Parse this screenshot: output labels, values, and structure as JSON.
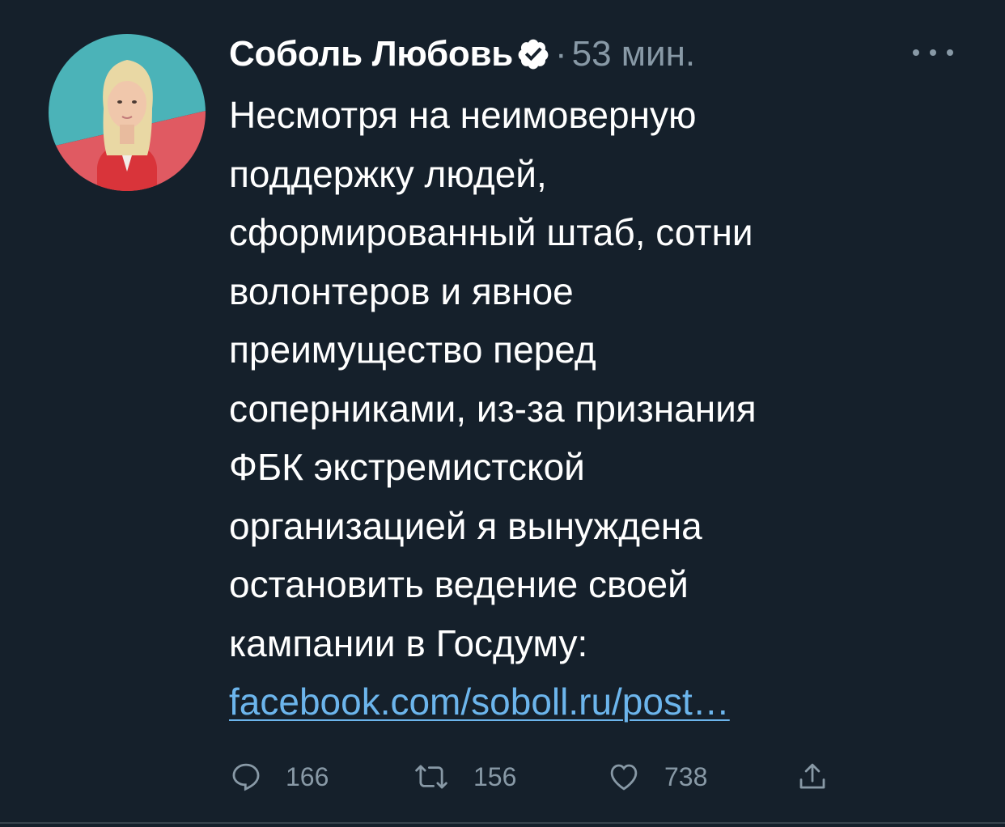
{
  "tweet": {
    "author_name": "Соболь Любовь",
    "separator": "·",
    "time": "53 мин.",
    "text_lines": [
      "Несмотря на неимоверную",
      "поддержку людей,",
      "сформированный штаб, сотни",
      "волонтеров и явное",
      "преимущество перед",
      "соперниками, из-за признания",
      "ФБК экстремистской",
      "организацией я вынуждена",
      "остановить ведение своей",
      "кампании в Госдуму:"
    ],
    "link": "facebook.com/soboll.ru/post…",
    "replies": "166",
    "retweets": "156",
    "likes": "738"
  },
  "icons": {
    "more": "more-icon",
    "verified": "verified-badge-icon",
    "reply": "reply-icon",
    "retweet": "retweet-icon",
    "like": "heart-icon",
    "share": "share-icon"
  },
  "colors": {
    "background": "#15202b",
    "text": "#ffffff",
    "muted": "#8899a6",
    "link": "#6cb5ec"
  }
}
